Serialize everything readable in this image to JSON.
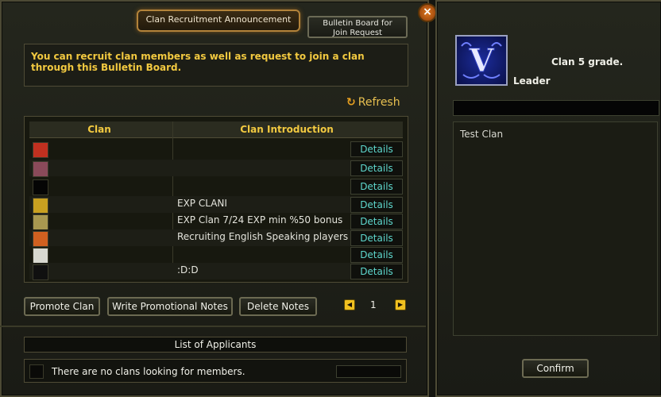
{
  "tabs": {
    "active": "Clan Recruitment Announcement",
    "inactive_line1": "Bulletin Board for",
    "inactive_line2": "Join Request"
  },
  "close_glyph": "×",
  "notice": "You can recruit clan members as well as request to join a clan through this Bulletin Board.",
  "refresh": {
    "icon": "refresh-icon",
    "label": "Refresh"
  },
  "table": {
    "headers": [
      "Clan",
      "Clan Introduction"
    ],
    "details_label": "Details",
    "rows": [
      {
        "icon_color": "#c03020",
        "intro": ""
      },
      {
        "icon_color": "#8a4a5a",
        "intro": ""
      },
      {
        "icon_color": "#050505",
        "intro": ""
      },
      {
        "icon_color": "#c8a020",
        "intro": "EXP CLANI"
      },
      {
        "icon_color": "#a89850",
        "intro": "EXP Clan 7/24 EXP min %50 bonus"
      },
      {
        "icon_color": "#d06020",
        "intro": "Recruiting English Speaking players"
      },
      {
        "icon_color": "#d8d8d0",
        "intro": ""
      },
      {
        "icon_color": "#101010",
        "intro": ":D:D"
      }
    ]
  },
  "buttons": {
    "promote": "Promote Clan",
    "write": "Write Promotional Notes",
    "delete": "Delete Notes",
    "confirm": "Confirm"
  },
  "pagination": {
    "page": "1",
    "prev_icon": "arrow-left-icon",
    "next_icon": "arrow-right-icon"
  },
  "applicants": {
    "header": "List of Applicants",
    "empty_message": "There are no clans looking for members."
  },
  "clan_info": {
    "emblem_letter": "V",
    "grade": "Clan 5 grade.",
    "role": "Leader",
    "notes": "Test Clan"
  },
  "colors": {
    "accent_gold": "#f2c940",
    "details_cyan": "#5ed7cd",
    "emblem_blue": "#1c2c9a"
  }
}
